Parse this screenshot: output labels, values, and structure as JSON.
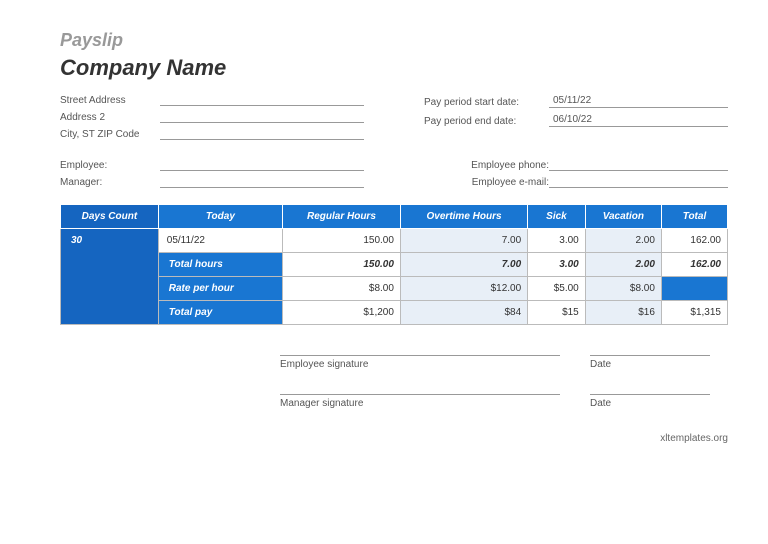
{
  "header": {
    "title": "Payslip",
    "company": "Company Name"
  },
  "address": {
    "street_label": "Street Address",
    "addr2_label": "Address 2",
    "city_label": "City, ST  ZIP Code"
  },
  "period": {
    "start_label": "Pay period start date:",
    "start_value": "05/11/22",
    "end_label": "Pay period end date:",
    "end_value": "06/10/22"
  },
  "people": {
    "employee_label": "Employee:",
    "manager_label": "Manager:",
    "phone_label": "Employee phone:",
    "email_label": "Employee e-mail:"
  },
  "table": {
    "headers": [
      "Days Count",
      "Today",
      "Regular Hours",
      "Overtime Hours",
      "Sick",
      "Vacation",
      "Total"
    ],
    "days_count": "30",
    "today": "05/11/22",
    "row1": {
      "regular": "150.00",
      "overtime": "7.00",
      "sick": "3.00",
      "vacation": "2.00",
      "total": "162.00"
    },
    "total_hours_label": "Total hours",
    "total_hours": {
      "regular": "150.00",
      "overtime": "7.00",
      "sick": "3.00",
      "vacation": "2.00",
      "total": "162.00"
    },
    "rate_label": "Rate per hour",
    "rate": {
      "regular": "$8.00",
      "overtime": "$12.00",
      "sick": "$5.00",
      "vacation": "$8.00",
      "total": ""
    },
    "pay_label": "Total pay",
    "pay": {
      "regular": "$1,200",
      "overtime": "$84",
      "sick": "$15",
      "vacation": "$16",
      "total": "$1,315"
    }
  },
  "signatures": {
    "emp_sig": "Employee signature",
    "mgr_sig": "Manager signature",
    "date": "Date"
  },
  "footer": "xltemplates.org"
}
